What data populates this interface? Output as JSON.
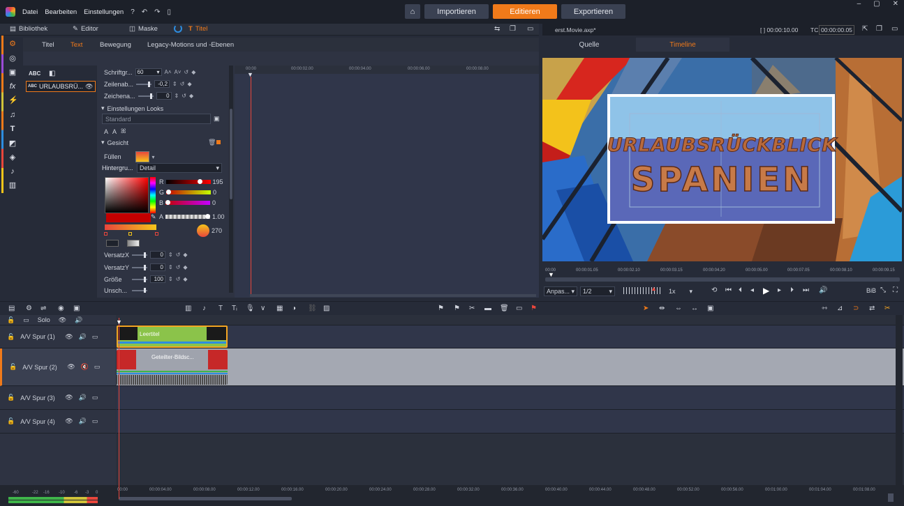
{
  "menu": {
    "items": [
      "Datei",
      "Bearbeiten",
      "Einstellungen"
    ]
  },
  "modes": [
    {
      "label": "Importieren",
      "active": false
    },
    {
      "label": "Editieren",
      "active": true
    },
    {
      "label": "Exportieren",
      "active": false
    }
  ],
  "tabs": {
    "library": "Bibliothek",
    "editor": "Editor",
    "mask": "Maske",
    "title": "Titel"
  },
  "title_tabs": [
    "Titel",
    "Text",
    "Bewegung",
    "Legacy-Motions und -Ebenen"
  ],
  "active_title_tab": "Text",
  "layers": {
    "abc_label": "ABC",
    "item_label": "URLAUBSRÜ..."
  },
  "props": {
    "font_size_label": "Schriftgr...",
    "font_size": "60",
    "line_spacing_label": "Zeilenab...",
    "line_spacing": "-0,2",
    "char_spacing_label": "Zeichena...",
    "char_spacing": "0",
    "looks_label": "Einstellungen Looks",
    "looks_value": "Standard",
    "face_label": "Gesicht",
    "fill_label": "Füllen",
    "background_label": "Hintergru...",
    "background_value": "Detail",
    "r_label": "R",
    "r_value": "195",
    "g_label": "G",
    "g_value": "0",
    "b_label": "B",
    "b_value": "0",
    "a_label": "A",
    "a_value": "1.00",
    "angle_value": "270",
    "offset_x_label": "VersatzX",
    "offset_x": "0",
    "offset_y_label": "VersatzY",
    "offset_y": "0",
    "size_label": "Größe",
    "size": "100",
    "blur_label": "Unsch..."
  },
  "title_timeline_ticks": [
    "00:00",
    "00:00:02.00",
    "00:00:04.00",
    "00:00:06.00",
    "00:00:08.00"
  ],
  "preview": {
    "filename": "erst.Movie.axp*",
    "duration": "[ ] 00:00:10.00",
    "tc_label": "TC",
    "timecode": "00:00:00.05",
    "tab_source": "Quelle",
    "tab_timeline": "Timeline",
    "title_line1": "URLAUBSRÜCKBLICK",
    "title_line2": "SPANIEN",
    "scrub_ticks": [
      "00:00",
      "00:00:01.05",
      "00:00:02.10",
      "00:00:03.15",
      "00:00:04.20",
      "00:00:05.00",
      "00:00:07.05",
      "00:00:08.10",
      "00:00:09.15"
    ],
    "fit_label": "Anpas...",
    "ratio": "1/2",
    "speed": "1x",
    "pip": "BiB"
  },
  "tracks": {
    "solo_label": "Solo",
    "rows": [
      {
        "name": "A/V Spur (1)"
      },
      {
        "name": "A/V Spur (2)"
      },
      {
        "name": "A/V Spur (3)"
      },
      {
        "name": "A/V Spur (4)"
      }
    ],
    "clip1_label": "Leertitel",
    "clip2_label": "Geteilter-Bildsc..."
  },
  "bottom_ticks": [
    "00:00",
    "00:00:04.00",
    "00:00:08.00",
    "00:00:12.00",
    "00:00:16.00",
    "00:00:20.00",
    "00:00:24.00",
    "00:00:28.00",
    "00:00:32.00",
    "00:00:36.00",
    "00:00:40.00",
    "00:00:44.00",
    "00:00:48.00",
    "00:00:52.00",
    "00:00:56.00",
    "00:01:00.00",
    "00:01:04.00",
    "00:01:08.00"
  ],
  "meter_ticks": [
    "-60",
    "-22",
    "-16",
    "-10",
    "-6",
    "-3",
    "0"
  ],
  "colors": {
    "accent": "#f07a1a",
    "fill_top": "#e8463c",
    "fill_bottom": "#f5c51a"
  }
}
